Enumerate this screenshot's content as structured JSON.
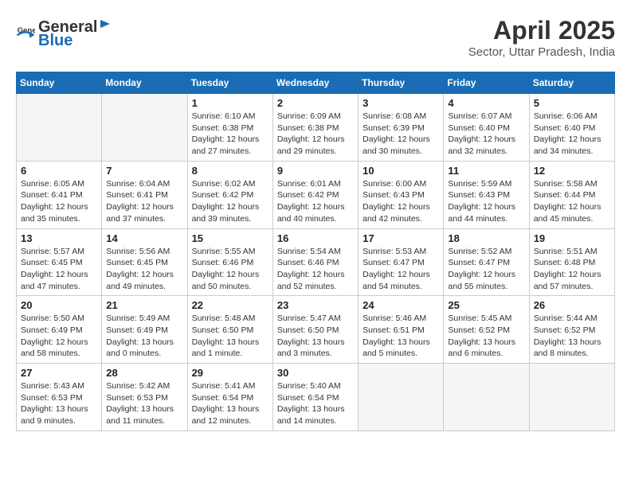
{
  "header": {
    "logo_general": "General",
    "logo_blue": "Blue",
    "month": "April 2025",
    "location": "Sector, Uttar Pradesh, India"
  },
  "weekdays": [
    "Sunday",
    "Monday",
    "Tuesday",
    "Wednesday",
    "Thursday",
    "Friday",
    "Saturday"
  ],
  "weeks": [
    [
      {
        "day": "",
        "info": ""
      },
      {
        "day": "",
        "info": ""
      },
      {
        "day": "1",
        "info": "Sunrise: 6:10 AM\nSunset: 6:38 PM\nDaylight: 12 hours and 27 minutes."
      },
      {
        "day": "2",
        "info": "Sunrise: 6:09 AM\nSunset: 6:38 PM\nDaylight: 12 hours and 29 minutes."
      },
      {
        "day": "3",
        "info": "Sunrise: 6:08 AM\nSunset: 6:39 PM\nDaylight: 12 hours and 30 minutes."
      },
      {
        "day": "4",
        "info": "Sunrise: 6:07 AM\nSunset: 6:40 PM\nDaylight: 12 hours and 32 minutes."
      },
      {
        "day": "5",
        "info": "Sunrise: 6:06 AM\nSunset: 6:40 PM\nDaylight: 12 hours and 34 minutes."
      }
    ],
    [
      {
        "day": "6",
        "info": "Sunrise: 6:05 AM\nSunset: 6:41 PM\nDaylight: 12 hours and 35 minutes."
      },
      {
        "day": "7",
        "info": "Sunrise: 6:04 AM\nSunset: 6:41 PM\nDaylight: 12 hours and 37 minutes."
      },
      {
        "day": "8",
        "info": "Sunrise: 6:02 AM\nSunset: 6:42 PM\nDaylight: 12 hours and 39 minutes."
      },
      {
        "day": "9",
        "info": "Sunrise: 6:01 AM\nSunset: 6:42 PM\nDaylight: 12 hours and 40 minutes."
      },
      {
        "day": "10",
        "info": "Sunrise: 6:00 AM\nSunset: 6:43 PM\nDaylight: 12 hours and 42 minutes."
      },
      {
        "day": "11",
        "info": "Sunrise: 5:59 AM\nSunset: 6:43 PM\nDaylight: 12 hours and 44 minutes."
      },
      {
        "day": "12",
        "info": "Sunrise: 5:58 AM\nSunset: 6:44 PM\nDaylight: 12 hours and 45 minutes."
      }
    ],
    [
      {
        "day": "13",
        "info": "Sunrise: 5:57 AM\nSunset: 6:45 PM\nDaylight: 12 hours and 47 minutes."
      },
      {
        "day": "14",
        "info": "Sunrise: 5:56 AM\nSunset: 6:45 PM\nDaylight: 12 hours and 49 minutes."
      },
      {
        "day": "15",
        "info": "Sunrise: 5:55 AM\nSunset: 6:46 PM\nDaylight: 12 hours and 50 minutes."
      },
      {
        "day": "16",
        "info": "Sunrise: 5:54 AM\nSunset: 6:46 PM\nDaylight: 12 hours and 52 minutes."
      },
      {
        "day": "17",
        "info": "Sunrise: 5:53 AM\nSunset: 6:47 PM\nDaylight: 12 hours and 54 minutes."
      },
      {
        "day": "18",
        "info": "Sunrise: 5:52 AM\nSunset: 6:47 PM\nDaylight: 12 hours and 55 minutes."
      },
      {
        "day": "19",
        "info": "Sunrise: 5:51 AM\nSunset: 6:48 PM\nDaylight: 12 hours and 57 minutes."
      }
    ],
    [
      {
        "day": "20",
        "info": "Sunrise: 5:50 AM\nSunset: 6:49 PM\nDaylight: 12 hours and 58 minutes."
      },
      {
        "day": "21",
        "info": "Sunrise: 5:49 AM\nSunset: 6:49 PM\nDaylight: 13 hours and 0 minutes."
      },
      {
        "day": "22",
        "info": "Sunrise: 5:48 AM\nSunset: 6:50 PM\nDaylight: 13 hours and 1 minute."
      },
      {
        "day": "23",
        "info": "Sunrise: 5:47 AM\nSunset: 6:50 PM\nDaylight: 13 hours and 3 minutes."
      },
      {
        "day": "24",
        "info": "Sunrise: 5:46 AM\nSunset: 6:51 PM\nDaylight: 13 hours and 5 minutes."
      },
      {
        "day": "25",
        "info": "Sunrise: 5:45 AM\nSunset: 6:52 PM\nDaylight: 13 hours and 6 minutes."
      },
      {
        "day": "26",
        "info": "Sunrise: 5:44 AM\nSunset: 6:52 PM\nDaylight: 13 hours and 8 minutes."
      }
    ],
    [
      {
        "day": "27",
        "info": "Sunrise: 5:43 AM\nSunset: 6:53 PM\nDaylight: 13 hours and 9 minutes."
      },
      {
        "day": "28",
        "info": "Sunrise: 5:42 AM\nSunset: 6:53 PM\nDaylight: 13 hours and 11 minutes."
      },
      {
        "day": "29",
        "info": "Sunrise: 5:41 AM\nSunset: 6:54 PM\nDaylight: 13 hours and 12 minutes."
      },
      {
        "day": "30",
        "info": "Sunrise: 5:40 AM\nSunset: 6:54 PM\nDaylight: 13 hours and 14 minutes."
      },
      {
        "day": "",
        "info": ""
      },
      {
        "day": "",
        "info": ""
      },
      {
        "day": "",
        "info": ""
      }
    ]
  ]
}
